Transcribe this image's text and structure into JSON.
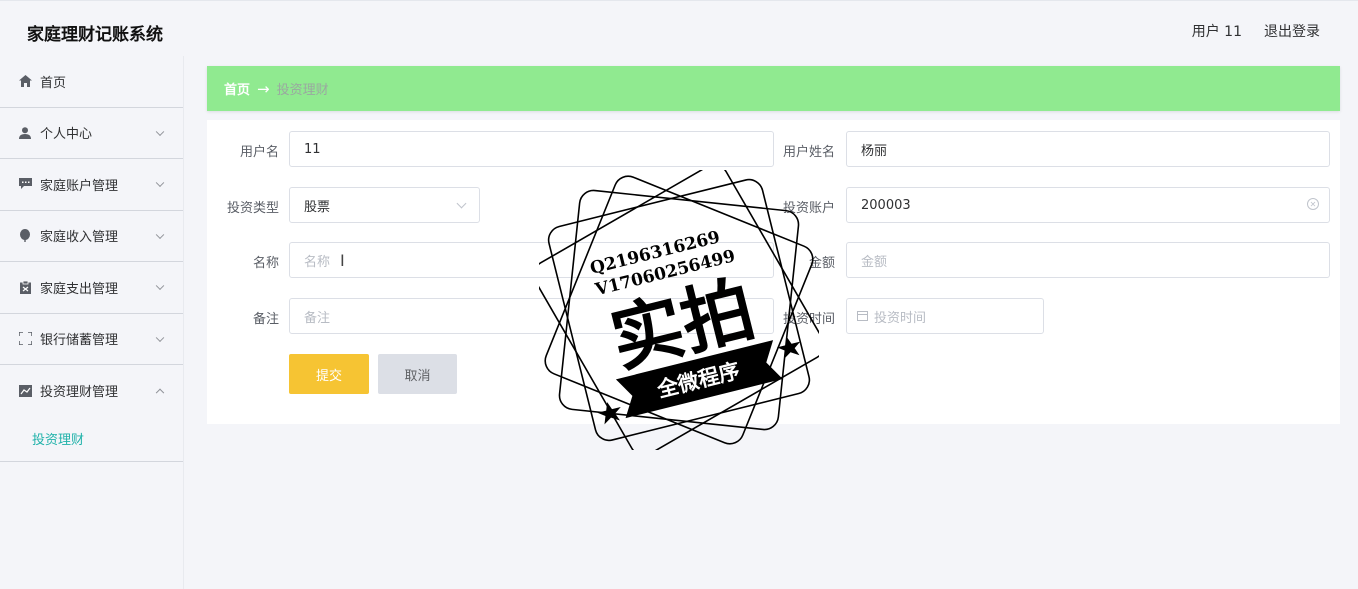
{
  "header": {
    "app_title": "家庭理财记账系统",
    "user_label": "用户 11",
    "logout_label": "退出登录"
  },
  "sidebar": {
    "items": [
      {
        "label": "首页",
        "icon": "home-icon"
      },
      {
        "label": "个人中心",
        "icon": "user-icon"
      },
      {
        "label": "家庭账户管理",
        "icon": "chat-icon"
      },
      {
        "label": "家庭收入管理",
        "icon": "leaf-icon"
      },
      {
        "label": "家庭支出管理",
        "icon": "clipboard-icon"
      },
      {
        "label": "银行储蓄管理",
        "icon": "fullscreen-icon"
      },
      {
        "label": "投资理财管理",
        "icon": "chart-icon"
      }
    ],
    "sub_item": "投资理财"
  },
  "breadcrumb": {
    "home": "首页",
    "arrow": "→",
    "current": "投资理财"
  },
  "form": {
    "username_label": "用户名",
    "username_value": "11",
    "fullname_label": "用户姓名",
    "fullname_value": "杨丽",
    "type_label": "投资类型",
    "type_value": "股票",
    "account_label": "投资账户",
    "account_value": "200003",
    "name_label": "名称",
    "name_placeholder": "名称",
    "amount_label": "金额",
    "amount_placeholder": "金额",
    "remark_label": "备注",
    "remark_placeholder": "备注",
    "time_label": "投资时间",
    "time_placeholder": "投资时间",
    "submit_label": "提交",
    "cancel_label": "取消"
  },
  "watermark": {
    "line1": "Q2196316269",
    "line2": "V17060256499",
    "big_text": "实拍",
    "ribbon_text": "全微程序"
  },
  "colors": {
    "breadcrumb_bg": "#90ea90",
    "submit_bg": "#f6c433",
    "active_menu": "#20b2aa"
  }
}
